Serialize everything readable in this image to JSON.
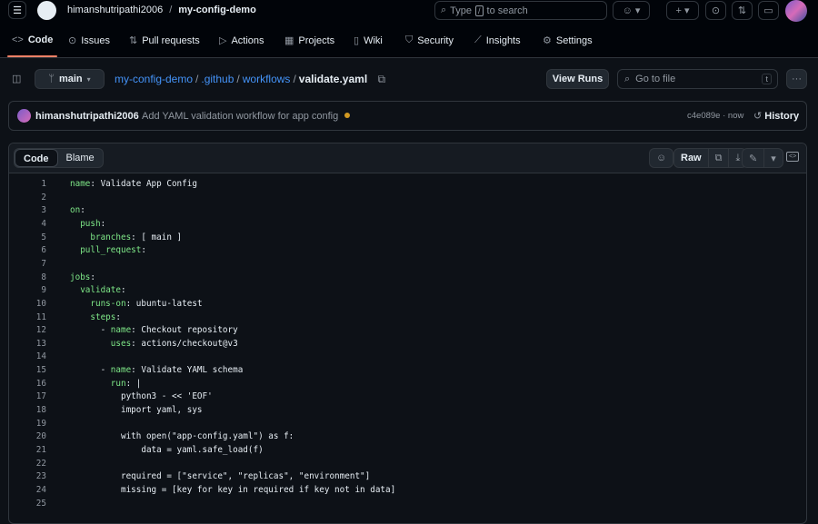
{
  "header": {
    "owner": "himanshutripathi2006",
    "repo": "my-config-demo",
    "search_placeholder_pre": "Type",
    "search_key": "/",
    "search_placeholder_post": "to search"
  },
  "nav": [
    {
      "label": "Code",
      "icon": "code-icon"
    },
    {
      "label": "Issues",
      "icon": "issue-icon"
    },
    {
      "label": "Pull requests",
      "icon": "pull-request-icon"
    },
    {
      "label": "Actions",
      "icon": "play-icon"
    },
    {
      "label": "Projects",
      "icon": "table-icon"
    },
    {
      "label": "Wiki",
      "icon": "book-icon"
    },
    {
      "label": "Security",
      "icon": "shield-icon"
    },
    {
      "label": "Insights",
      "icon": "graph-icon"
    },
    {
      "label": "Settings",
      "icon": "gear-icon"
    }
  ],
  "file_bar": {
    "branch": "main",
    "path": [
      "my-config-demo",
      ".github",
      "workflows"
    ],
    "file": "validate.yaml",
    "view_runs": "View Runs",
    "goto_placeholder": "Go to file",
    "goto_key": "t"
  },
  "commit": {
    "author": "himanshutripathi2006",
    "message": "Add YAML validation workflow for app config",
    "sha": "c4e089e",
    "time": "now",
    "history": "History",
    "status_color": "#d29922"
  },
  "viewer": {
    "tabs": [
      "Code",
      "Blame"
    ],
    "active_tab": "Code",
    "raw": "Raw"
  },
  "code": [
    {
      "n": "1",
      "pre": "",
      "key": "name",
      "rest": ": Validate App Config"
    },
    {
      "n": "2",
      "pre": "",
      "key": "",
      "rest": ""
    },
    {
      "n": "3",
      "pre": "",
      "key": "on",
      "rest": ":"
    },
    {
      "n": "4",
      "pre": "  ",
      "key": "push",
      "rest": ":"
    },
    {
      "n": "5",
      "pre": "    ",
      "key": "branches",
      "rest": ": [ main ]"
    },
    {
      "n": "6",
      "pre": "  ",
      "key": "pull_request",
      "rest": ":"
    },
    {
      "n": "7",
      "pre": "",
      "key": "",
      "rest": ""
    },
    {
      "n": "8",
      "pre": "",
      "key": "jobs",
      "rest": ":"
    },
    {
      "n": "9",
      "pre": "  ",
      "key": "validate",
      "rest": ":"
    },
    {
      "n": "10",
      "pre": "    ",
      "key": "runs-on",
      "rest": ": ubuntu-latest"
    },
    {
      "n": "11",
      "pre": "    ",
      "key": "steps",
      "rest": ":"
    },
    {
      "n": "12",
      "pre": "      - ",
      "key": "name",
      "rest": ": Checkout repository"
    },
    {
      "n": "13",
      "pre": "        ",
      "key": "uses",
      "rest": ": actions/checkout@v3"
    },
    {
      "n": "14",
      "pre": "",
      "key": "",
      "rest": ""
    },
    {
      "n": "15",
      "pre": "      - ",
      "key": "name",
      "rest": ": Validate YAML schema"
    },
    {
      "n": "16",
      "pre": "        ",
      "key": "run",
      "rest": ": |"
    },
    {
      "n": "17",
      "pre": "          python3 - << 'EOF'",
      "key": "",
      "rest": ""
    },
    {
      "n": "18",
      "pre": "          import yaml, sys",
      "key": "",
      "rest": ""
    },
    {
      "n": "19",
      "pre": "",
      "key": "",
      "rest": ""
    },
    {
      "n": "20",
      "pre": "          with open(\"app-config.yaml\") as f:",
      "key": "",
      "rest": ""
    },
    {
      "n": "21",
      "pre": "              data = yaml.safe_load(f)",
      "key": "",
      "rest": ""
    },
    {
      "n": "22",
      "pre": "",
      "key": "",
      "rest": ""
    },
    {
      "n": "23",
      "pre": "          required = [\"service\", \"replicas\", \"environment\"]",
      "key": "",
      "rest": ""
    },
    {
      "n": "24",
      "pre": "          missing = [key for key in required if key not in data]",
      "key": "",
      "rest": ""
    },
    {
      "n": "25",
      "pre": "",
      "key": "",
      "rest": ""
    }
  ]
}
